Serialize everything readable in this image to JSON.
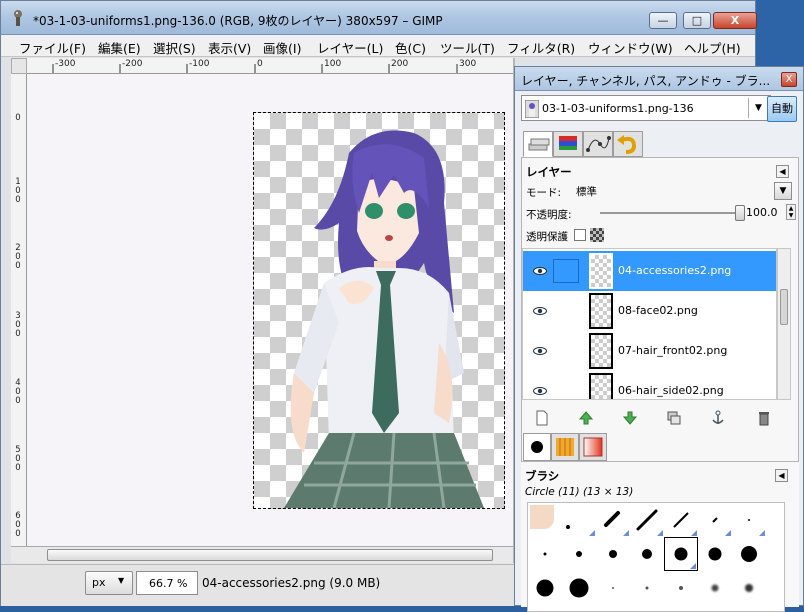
{
  "window": {
    "title": "*03-1-03-uniforms1.png-136.0 (RGB, 9枚のレイヤー) 380x597 – GIMP",
    "minimize_glyph": "—",
    "maximize_glyph": "□",
    "close_glyph": "X"
  },
  "menu": [
    "ファイル(F)",
    "編集(E)",
    "選択(S)",
    "表示(V)",
    "画像(I)",
    "レイヤー(L)",
    "色(C)",
    "ツール(T)",
    "フィルタ(R)",
    "ウィンドウ(W)",
    "ヘルプ(H)"
  ],
  "ruler_h": [
    "-300",
    "-200",
    "-100",
    "0",
    "100",
    "200",
    "300"
  ],
  "ruler_v": [
    "0",
    "1\n0\n0",
    "2\n0\n0",
    "3\n0\n0",
    "4\n0\n0",
    "5\n0\n0",
    "6\n0\n0"
  ],
  "status": {
    "unit": "px",
    "zoom": "66.7 %",
    "info": "04-accessories2.png (9.0 MB)"
  },
  "dock": {
    "title": "レイヤー, チャンネル, パス, アンドゥ - ブラ...",
    "close_glyph": "X",
    "image_name": "03-1-03-uniforms1.png-136",
    "auto_label": "自動",
    "layers": {
      "heading": "レイヤー",
      "mode_label": "モード:",
      "mode_value": "標準",
      "opacity_label": "不透明度:",
      "opacity_value": "100.0",
      "lock_label": "透明保護",
      "items": [
        {
          "name": "04-accessories2.png",
          "selected": true
        },
        {
          "name": "08-face02.png",
          "selected": false
        },
        {
          "name": "07-hair_front02.png",
          "selected": false
        },
        {
          "name": "06-hair_side02.png",
          "selected": false
        }
      ]
    },
    "brushes": {
      "heading": "ブラシ",
      "current": "Circle (11) (13 × 13)"
    }
  },
  "colors": {
    "selection": "#3399ff",
    "titlebar": "#aec6e2"
  }
}
